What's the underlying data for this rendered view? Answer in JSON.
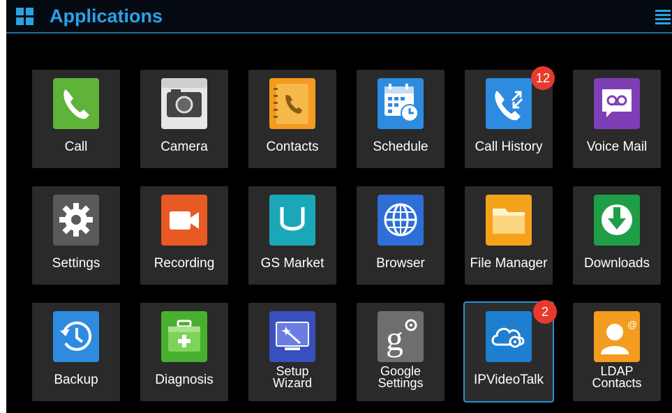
{
  "header": {
    "title": "Applications"
  },
  "apps": [
    {
      "label": "Call",
      "icon": "call-icon"
    },
    {
      "label": "Camera",
      "icon": "camera-icon"
    },
    {
      "label": "Contacts",
      "icon": "contacts-icon"
    },
    {
      "label": "Schedule",
      "icon": "schedule-icon"
    },
    {
      "label": "Call History",
      "icon": "call-history-icon",
      "badge": "12"
    },
    {
      "label": "Voice Mail",
      "icon": "voicemail-icon"
    },
    {
      "label": "Settings",
      "icon": "settings-icon"
    },
    {
      "label": "Recording",
      "icon": "recording-icon"
    },
    {
      "label": "GS Market",
      "icon": "market-icon"
    },
    {
      "label": "Browser",
      "icon": "browser-icon"
    },
    {
      "label": "File Manager",
      "icon": "folder-icon"
    },
    {
      "label": "Downloads",
      "icon": "download-icon"
    },
    {
      "label": "Backup",
      "icon": "backup-icon"
    },
    {
      "label": "Diagnosis",
      "icon": "diagnosis-icon"
    },
    {
      "label_line1": "Setup",
      "label_line2": "Wizard",
      "icon": "setup-wizard-icon"
    },
    {
      "label_line1": "Google",
      "label_line2": "Settings",
      "icon": "google-settings-icon"
    },
    {
      "label": "IPVideoTalk",
      "icon": "ipvideotalk-icon",
      "badge": "2"
    },
    {
      "label_line1": "LDAP",
      "label_line2": "Contacts",
      "icon": "ldap-contacts-icon"
    }
  ]
}
